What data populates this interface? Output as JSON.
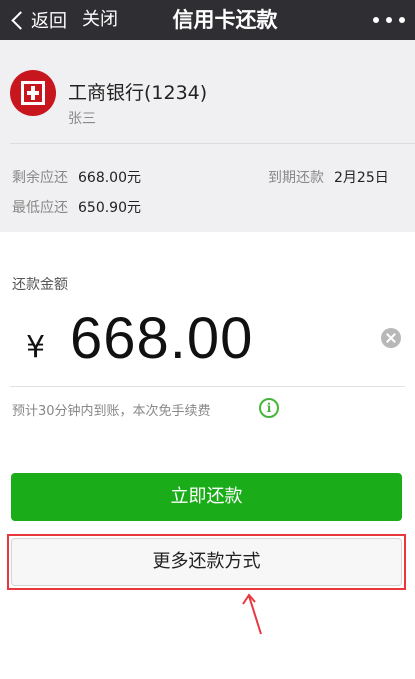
{
  "topbar": {
    "back_label": "返回",
    "close_label": "关闭",
    "title": "信用卡还款"
  },
  "card": {
    "bank_name": "工商银行(1234)",
    "holder": "张三",
    "remaining_label": "剩余应还",
    "remaining_value": "668.00元",
    "minimum_label": "最低应还",
    "minimum_value": "650.90元",
    "due_label": "到期还款",
    "due_value": "2月25日"
  },
  "payment": {
    "amount_label": "还款金额",
    "currency_symbol": "¥",
    "amount": "668.00",
    "note": "预计30分钟内到账，本次免手续费",
    "info_icon_glyph": "i"
  },
  "actions": {
    "pay_now_label": "立即还款",
    "more_methods_label": "更多还款方式"
  },
  "colors": {
    "topbar_bg": "#2e2e33",
    "bank_red": "#c8161e",
    "primary_green": "#1aad19",
    "info_green": "#45b53a",
    "highlight_red": "#e8383d"
  }
}
